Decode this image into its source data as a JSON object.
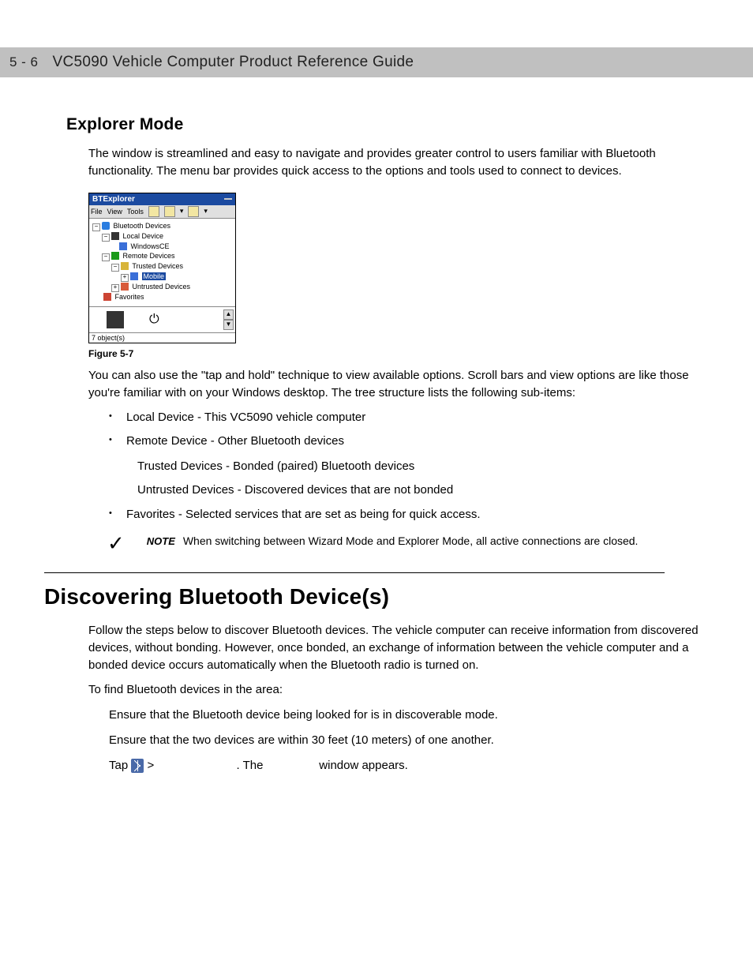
{
  "header": {
    "page_num": "5 - 6",
    "doc_title": "VC5090 Vehicle Computer Product Reference Guide"
  },
  "section1": {
    "heading": "Explorer Mode",
    "p1_a": "The ",
    "p1_b": " window is streamlined and easy to navigate and provides greater control to users familiar with Bluetooth functionality. The menu bar provides quick access to the options and tools used to connect to devices.",
    "fig": {
      "title": "BTExplorer",
      "menu": {
        "file": "File",
        "view": "View",
        "tools": "Tools"
      },
      "tree": {
        "root": "Bluetooth Devices",
        "local": "Local Device",
        "winCE": "WindowsCE",
        "remote": "Remote Devices",
        "trusted": "Trusted Devices",
        "mobile": "Mobile",
        "untrusted": "Untrusted Devices",
        "favorites": "Favorites"
      },
      "status": "7 object(s)"
    },
    "caption": "Figure 5-7",
    "p2": "You can also use the \"tap and hold\" technique to view available options. Scroll bars and view options are like those you're familiar with on your Windows desktop. The tree structure lists the following sub-items:",
    "bullets": {
      "b1": "Local Device - This VC5090 vehicle computer",
      "b2": "Remote Device - Other Bluetooth devices",
      "b2a": "Trusted Devices - Bonded (paired) Bluetooth devices",
      "b2b": "Untrusted Devices - Discovered devices that are not bonded",
      "b3_a": "Favorites - Selected services that are set as being ",
      "b3_b": " for quick access."
    },
    "note": {
      "label": "NOTE",
      "text": "When switching between Wizard Mode and Explorer Mode, all active connections are closed."
    }
  },
  "section2": {
    "heading": "Discovering Bluetooth Device(s)",
    "p1": "Follow the steps below to discover Bluetooth devices. The vehicle computer can receive information from discovered devices, without bonding. However, once bonded, an exchange of information between the vehicle computer and a bonded device occurs automatically when the Bluetooth radio is turned on.",
    "p2": "To find Bluetooth devices in the area:",
    "s1": "Ensure that the Bluetooth device being looked for is in discoverable mode.",
    "s2": "Ensure that the two devices are within 30 feet (10 meters) of one another.",
    "s3_a": "Tap ",
    "s3_b": " > ",
    "s3_c": ". The ",
    "s3_d": " window appears."
  }
}
